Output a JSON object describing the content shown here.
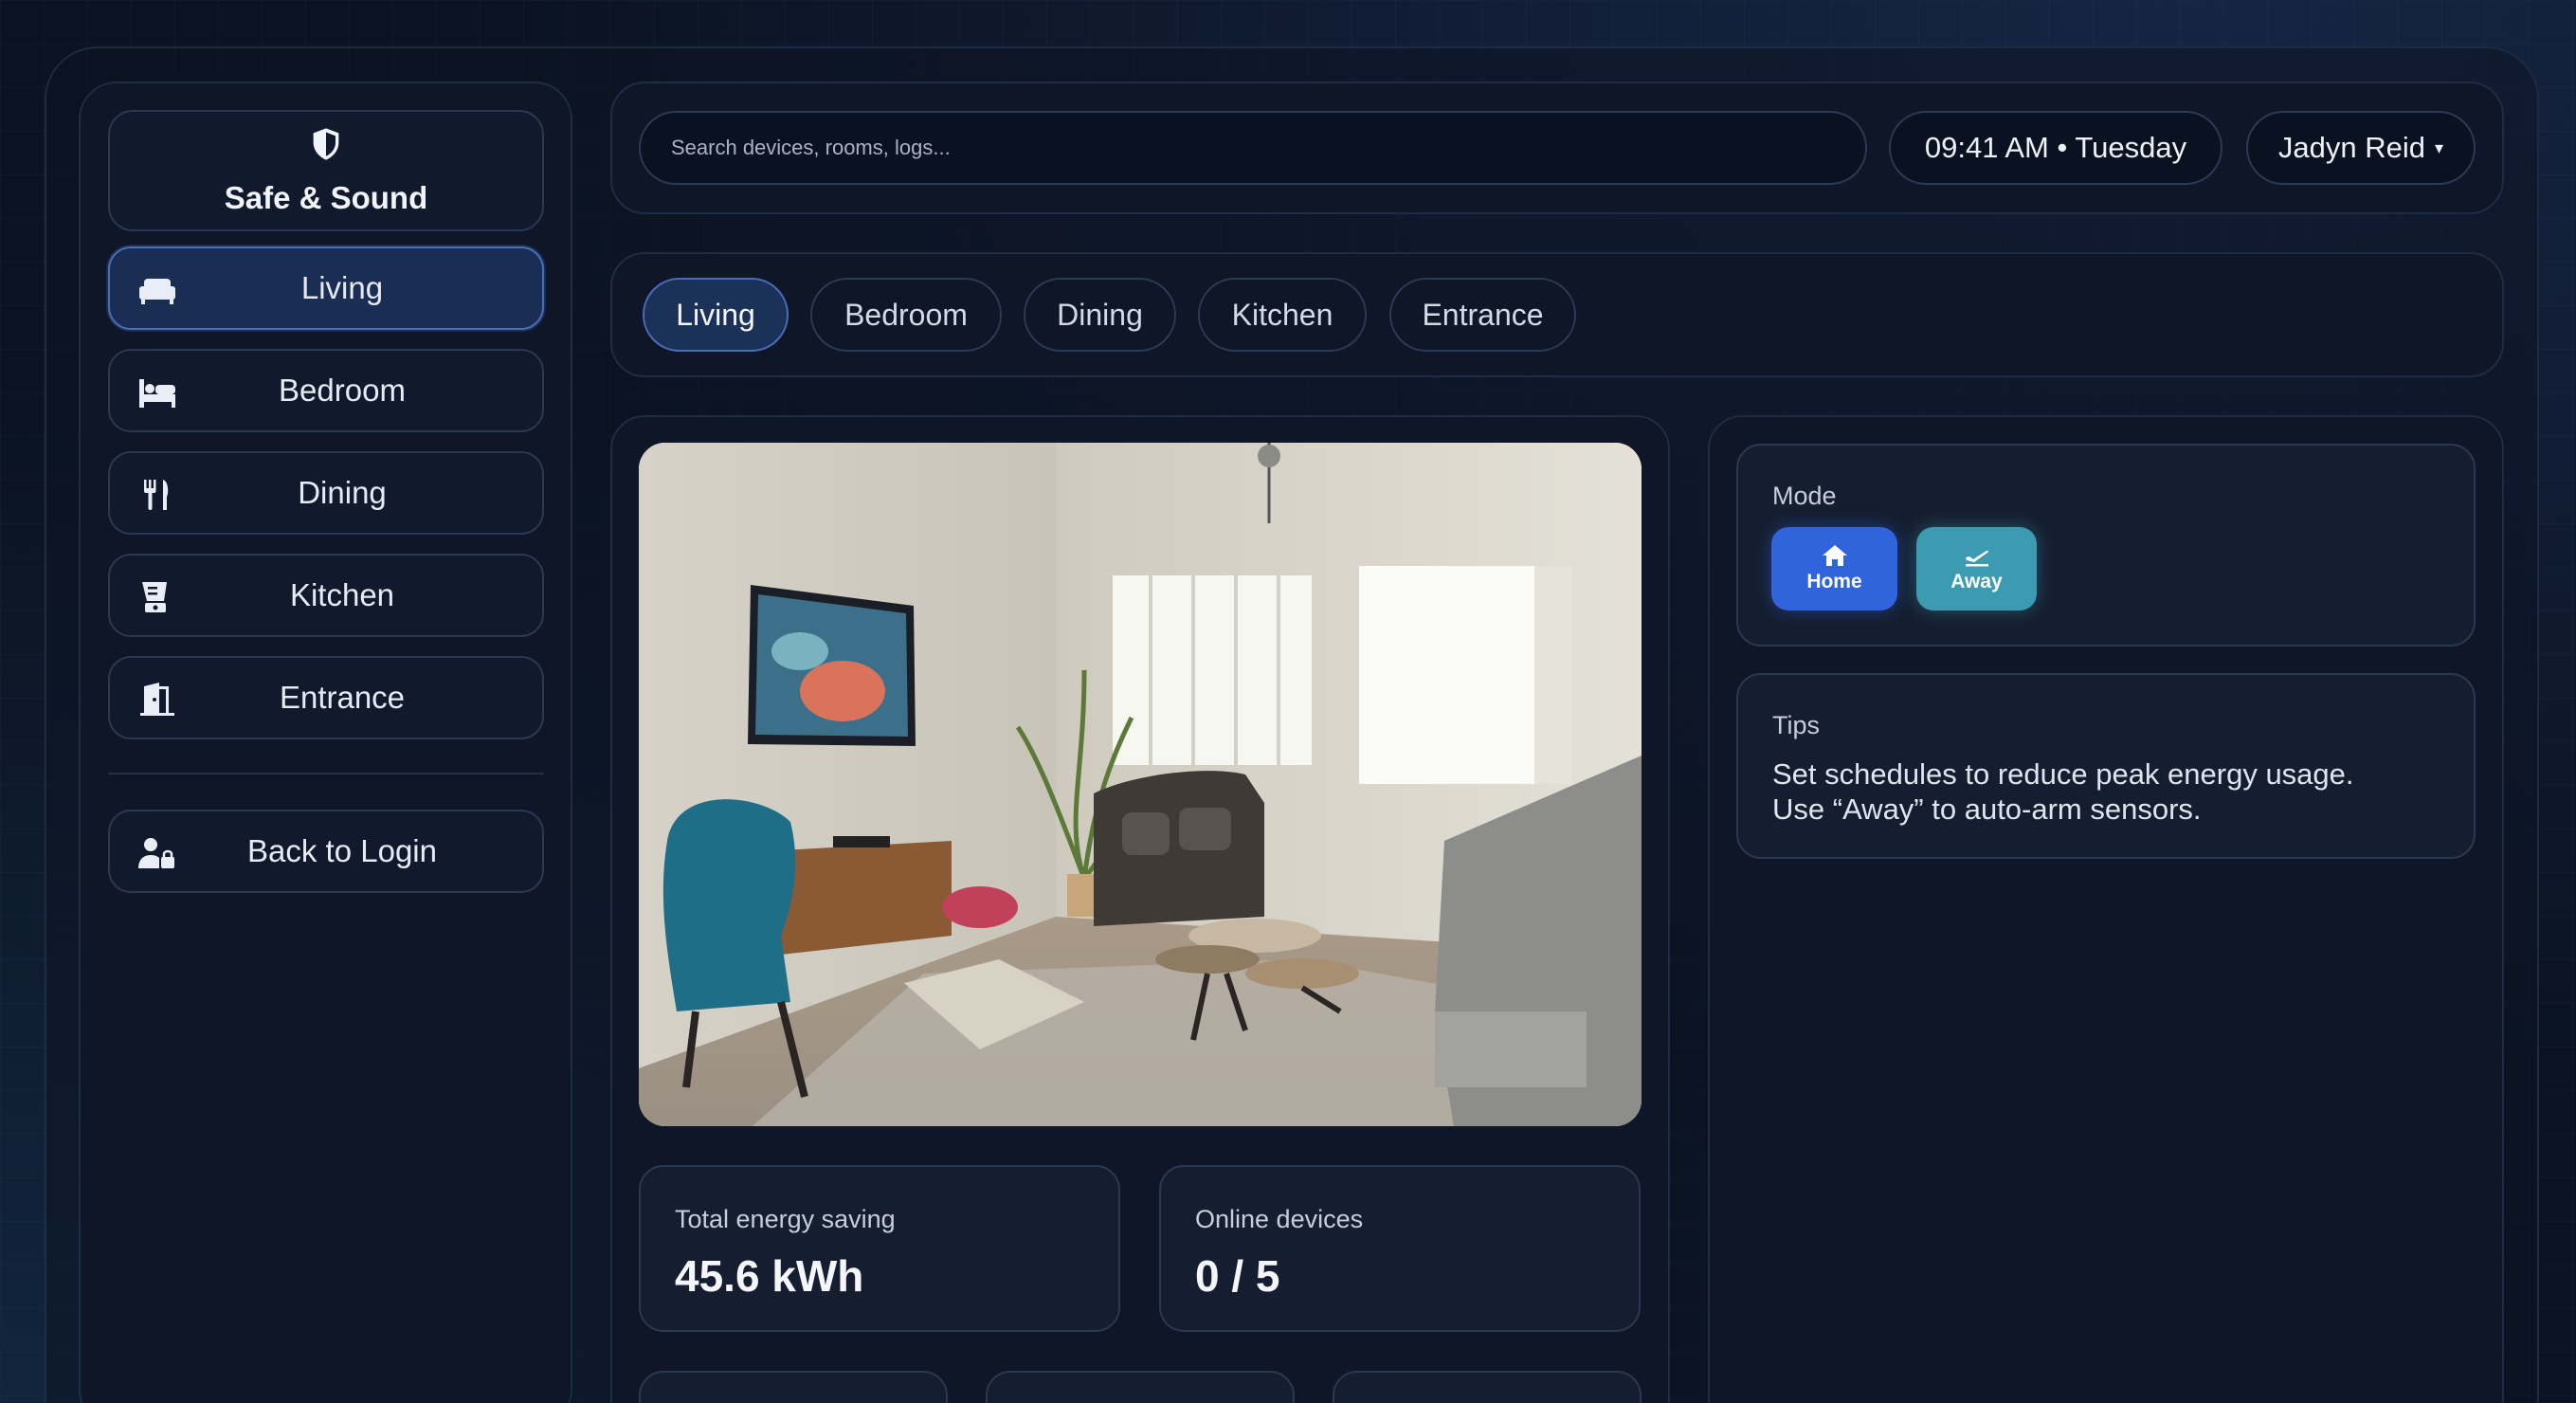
{
  "brand": {
    "title": "Safe & Sound",
    "icon": "shield-icon"
  },
  "sidebar": {
    "items": [
      {
        "label": "Living",
        "icon": "sofa-icon",
        "active": true
      },
      {
        "label": "Bedroom",
        "icon": "bed-icon",
        "active": false
      },
      {
        "label": "Dining",
        "icon": "utensils-icon",
        "active": false
      },
      {
        "label": "Kitchen",
        "icon": "blender-icon",
        "active": false
      },
      {
        "label": "Entrance",
        "icon": "door-icon",
        "active": false
      }
    ],
    "logout": {
      "label": "Back to Login",
      "icon": "user-lock-icon"
    }
  },
  "header": {
    "search_placeholder": "Search devices, rooms, logs...",
    "clock": "09:41 AM • Tuesday",
    "user_name": "Jadyn Reid",
    "user_caret": "▾"
  },
  "tabs": [
    {
      "label": "Living",
      "active": true
    },
    {
      "label": "Bedroom",
      "active": false
    },
    {
      "label": "Dining",
      "active": false
    },
    {
      "label": "Kitchen",
      "active": false
    },
    {
      "label": "Entrance",
      "active": false
    }
  ],
  "stats": {
    "energy": {
      "caption": "Total energy saving",
      "value": "45.6 kWh"
    },
    "devices": {
      "caption": "Online devices",
      "value": "0 / 5"
    }
  },
  "mode": {
    "title": "Mode",
    "home_label": "Home",
    "away_label": "Away"
  },
  "tips": {
    "title": "Tips",
    "line1": "Set schedules to reduce peak energy usage.",
    "line2": "Use “Away” to auto-arm sensors."
  },
  "colors": {
    "accent_blue": "#2f64dc",
    "accent_teal": "#3c9bb0",
    "active_nav": "#1a2d52",
    "background": "#0b1322"
  }
}
